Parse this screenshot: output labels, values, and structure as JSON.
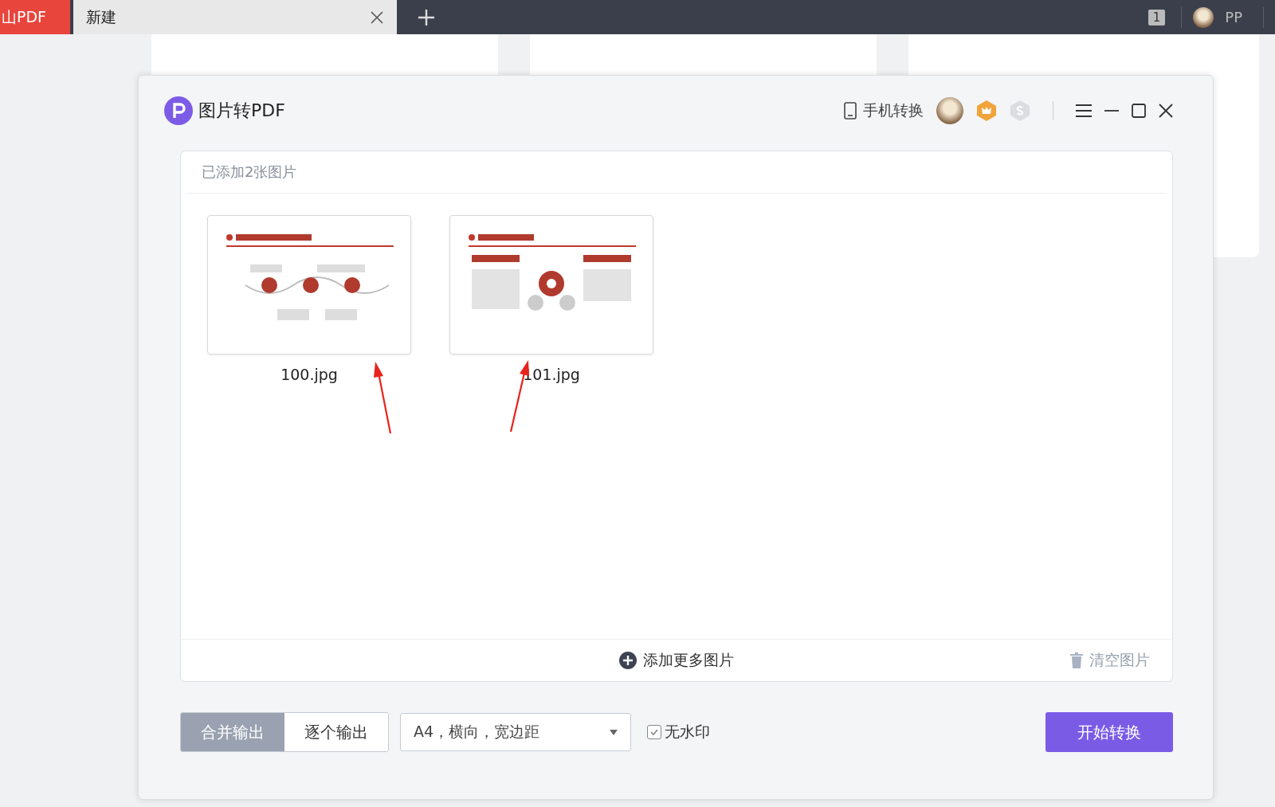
{
  "brand": "山PDF",
  "tabs": [
    {
      "label": "新建",
      "selected": true
    }
  ],
  "top_right": {
    "badge": "1",
    "user": "PP"
  },
  "dialog": {
    "title": "图片转PDF",
    "phone_convert": "手机转换",
    "images_header": "已添加2张图片",
    "images": [
      {
        "name": "100.jpg",
        "kind": "picture"
      },
      {
        "name": "101.jpg",
        "kind": "picture"
      }
    ],
    "add_more": "添加更多图片",
    "clear": "清空图片",
    "output_modes": [
      {
        "label": "合并输出",
        "selected": true
      },
      {
        "label": "逐个输出",
        "selected": false
      }
    ],
    "page_setting": "A4，横向，宽边距",
    "no_watermark": {
      "label": "无水印",
      "checked": true
    },
    "start": "开始转换"
  }
}
